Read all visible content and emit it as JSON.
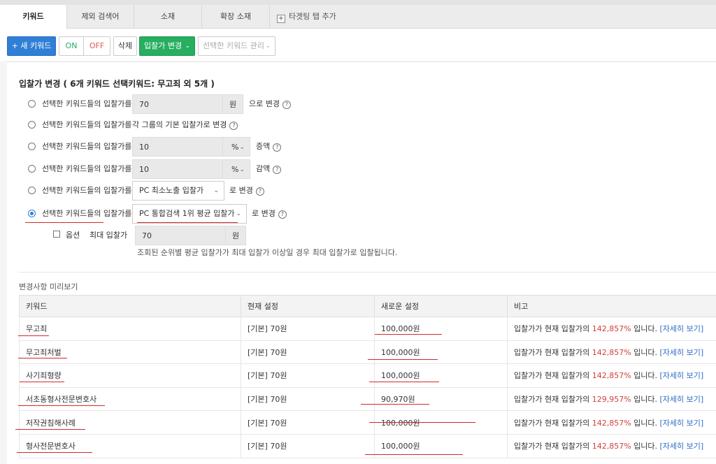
{
  "tabs": [
    {
      "label": "키워드",
      "active": true
    },
    {
      "label": "제외 검색어",
      "active": false
    },
    {
      "label": "소재",
      "active": false
    },
    {
      "label": "확장 소재",
      "active": false
    },
    {
      "label": "타겟팅 탭 추가",
      "active": false
    }
  ],
  "toolbar": {
    "new_keyword": "+ 새 키워드",
    "on": "ON",
    "off": "OFF",
    "delete": "삭제",
    "bid_change": "입찰가 변경",
    "manage": "선택한 키워드 관리"
  },
  "bid_panel": {
    "title": "입찰가 변경 ( 6개 키워드 선택키워드: 무고죄 외 5개 )",
    "options": [
      {
        "label": "선택한 키워드들의 입찰가를",
        "value": "70",
        "unit": "원",
        "suffix": "으로 변경",
        "checked": false
      },
      {
        "label": "선택한 키워드들의 입찰가를",
        "suffix": "각 그룹의 기본 입찰가로 변경",
        "checked": false
      },
      {
        "label": "선택한 키워드들의 입찰가를",
        "value": "10",
        "unit": "%",
        "suffix": "증액",
        "checked": false
      },
      {
        "label": "선택한 키워드들의 입찰가를",
        "value": "10",
        "unit": "%",
        "suffix": "감액",
        "checked": false
      },
      {
        "label": "선택한 키워드들의 입찰가를",
        "select": "PC 최소노출 입찰가",
        "suffix": "로 변경",
        "checked": false
      },
      {
        "label": "선택한 키워드들의 입찰가를",
        "select": "PC 통합검색 1위 평균 입찰가",
        "suffix": "로 변경",
        "checked": true
      }
    ],
    "option_label": "옵션",
    "max_bid_label": "최대 입찰가",
    "max_bid_value": "70",
    "max_bid_unit": "원",
    "note": "조회된 순위별 평균 입찰가가 최대 입찰가 이상일 경우 최대 입찰가로 입찰됩니다."
  },
  "preview": {
    "title": "변경사항 미리보기",
    "columns": [
      "키워드",
      "현재 설정",
      "새로운 설정",
      "비고"
    ],
    "rows": [
      {
        "keyword": "무고죄",
        "current": "[기본] 70원",
        "new": "100,000원",
        "note_pre": "입찰가가 현재 입찰가의",
        "pct": "142,857%",
        "note_post": "입니다.",
        "link": "[자세히 보기]"
      },
      {
        "keyword": "무고죄처벌",
        "current": "[기본] 70원",
        "new": "100,000원",
        "note_pre": "입찰가가 현재 입찰가의",
        "pct": "142,857%",
        "note_post": "입니다.",
        "link": "[자세히 보기]"
      },
      {
        "keyword": "사기죄형량",
        "current": "[기본] 70원",
        "new": "100,000원",
        "note_pre": "입찰가가 현재 입찰가의",
        "pct": "142,857%",
        "note_post": "입니다.",
        "link": "[자세히 보기]"
      },
      {
        "keyword": "서초동형사전문변호사",
        "current": "[기본] 70원",
        "new": "90,970원",
        "note_pre": "입찰가가 현재 입찰가의",
        "pct": "129,957%",
        "note_post": "입니다.",
        "link": "[자세히 보기]"
      },
      {
        "keyword": "저작권침해사례",
        "current": "[기본] 70원",
        "new": "100,000원",
        "note_pre": "입찰가가 현재 입찰가의",
        "pct": "142,857%",
        "note_post": "입니다.",
        "link": "[자세히 보기]"
      },
      {
        "keyword": "형사전문변호사",
        "current": "[기본] 70원",
        "new": "100,000원",
        "note_pre": "입찰가가 현재 입찰가의",
        "pct": "142,857%",
        "note_post": "입니다.",
        "link": "[자세히 보기]"
      }
    ]
  },
  "icons": {
    "help": "question-circle-icon",
    "caret": "chevron-down-icon",
    "radio": "radio-icon"
  },
  "colors": {
    "primary": "#2f7fd6",
    "green": "#27ae60",
    "red": "#d0413a",
    "annotation": "#d12b2b"
  }
}
